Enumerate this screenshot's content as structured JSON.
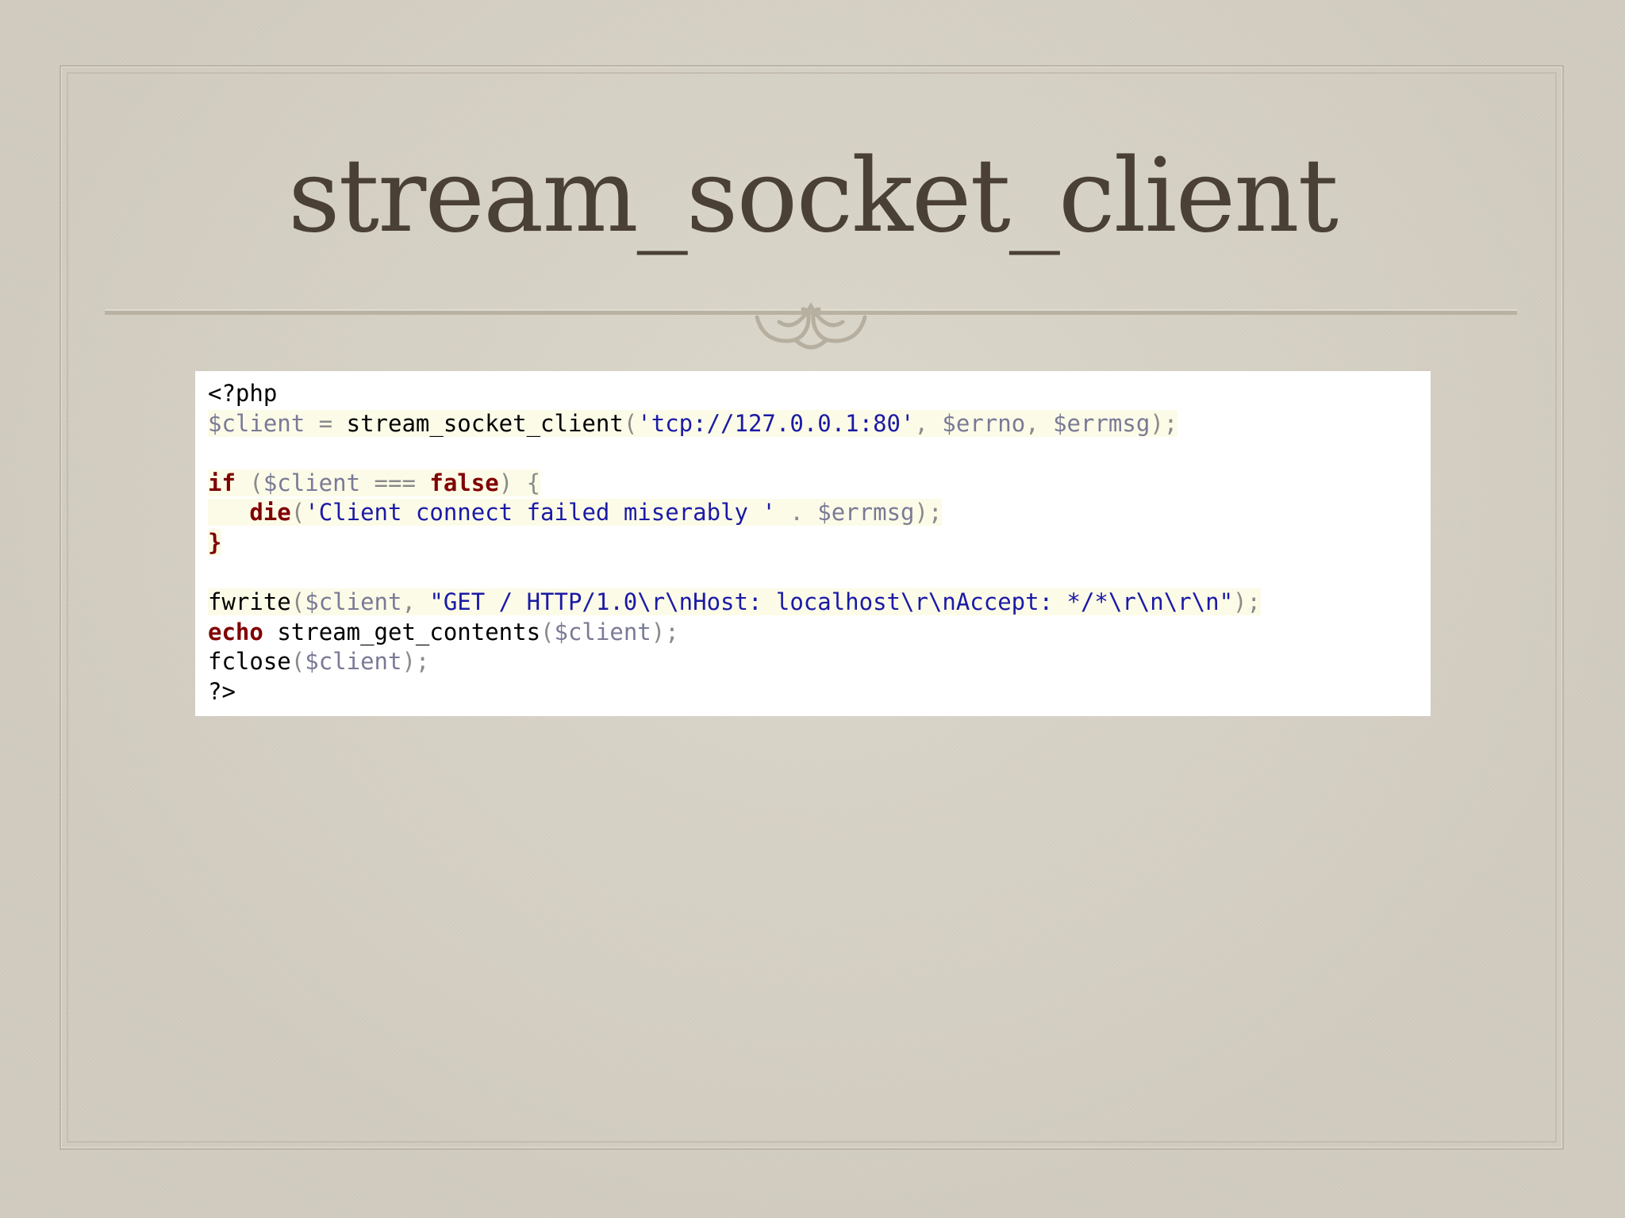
{
  "slide": {
    "title": "stream_socket_client"
  },
  "code": {
    "line1": {
      "open": "<?php"
    },
    "line2": {
      "var": "$client",
      "op": " = ",
      "func": "stream_socket_client",
      "paren_open": "(",
      "str": "'tcp://127.0.0.1:80'",
      "comma1": ", ",
      "arg2": "$errno",
      "comma2": ", ",
      "arg3": "$errmsg",
      "close": ");"
    },
    "line4": {
      "kw_if": "if",
      "paren_open": " (",
      "var": "$client",
      "op": " === ",
      "kw_false": "false",
      "paren_close": ") {"
    },
    "line5": {
      "indent": "   ",
      "kw_die": "die",
      "paren_open": "(",
      "str": "'Client connect failed miserably '",
      "concat": " . ",
      "var": "$errmsg",
      "close": ");"
    },
    "line6": {
      "brace": "}"
    },
    "line8": {
      "func": "fwrite",
      "paren_open": "(",
      "var": "$client",
      "comma": ", ",
      "str": "\"GET / HTTP/1.0\\r\\nHost: localhost\\r\\nAccept: */*\\r\\n\\r\\n\"",
      "close": ");"
    },
    "line9": {
      "kw_echo": "echo",
      "space": " ",
      "func": "stream_get_contents",
      "paren_open": "(",
      "var": "$client",
      "close": ");"
    },
    "line10": {
      "func": "fclose",
      "paren_open": "(",
      "var": "$client",
      "close": ");"
    },
    "line11": {
      "close_tag": "?>"
    }
  },
  "colors": {
    "background": "#d9d3c6",
    "title": "#4a4036",
    "keyword": "#800000",
    "string": "#1a1aa6",
    "variable": "#7a7a96",
    "code_background": "#ffffff"
  }
}
